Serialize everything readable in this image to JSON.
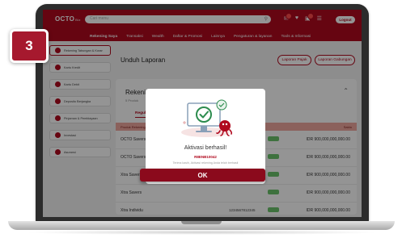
{
  "step": {
    "number": "3"
  },
  "topbar": {
    "logo": "OCTO",
    "logo_sub": "Biz",
    "search_placeholder": "Cari menu",
    "logout_label": "Logout"
  },
  "nav": {
    "items": [
      "Rekening Saya",
      "Transaksi",
      "Wealth",
      "Daftar & Promosi",
      "Lainnya",
      "Pengaturan & layanan",
      "Tools & Informasi"
    ]
  },
  "sidebar": {
    "items": [
      "Rekening Tabungan & Koran",
      "Kartu Kredit",
      "Kartu Debit",
      "Deposito Berjangka",
      "Pinjaman & Pembiayaan",
      "Investasi",
      "Asuransi"
    ]
  },
  "main": {
    "title": "Unduh Laporan",
    "btn_tax": "Laporan Pajak",
    "btn_group": "Laporan Gabungan",
    "card_title": "Rekening Tabungan & Koran",
    "card_sub": "5 Produk",
    "tab": "Reguler",
    "col_product": "Produk Rekening",
    "col_balance": "Saldo",
    "rows": [
      {
        "name": "OCTO Savers",
        "number": "",
        "amount": "IDR 900,000,000,000.00"
      },
      {
        "name": "OCTO Savers",
        "number": "",
        "amount": "IDR 900,000,000,000.00"
      },
      {
        "name": "Xtra Savers",
        "number": "",
        "amount": "IDR 900,000,000,000.00"
      },
      {
        "name": "Xtra Savers",
        "number": "",
        "amount": "IDR 900,000,000,000.00"
      },
      {
        "name": "Xtra Individu",
        "number": "1234567812345",
        "amount": "IDR 900,000,000,000.00"
      }
    ]
  },
  "modal": {
    "title": "Aktivasi berhasil!",
    "reference": "R8ENB10042",
    "message": "Terima kasih, Aktivasi rekening Anda telah berhasil",
    "ok_label": "OK"
  },
  "colors": {
    "brand": "#b0091e",
    "ok_button": "#8b0a1c",
    "step_badge": "#a6192e",
    "success": "#2d8c4e"
  }
}
